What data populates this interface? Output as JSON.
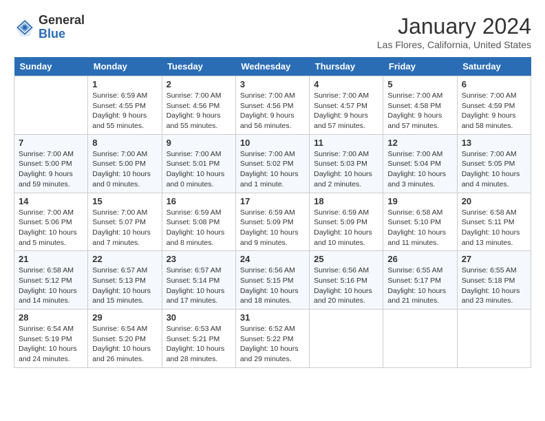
{
  "header": {
    "logo_general": "General",
    "logo_blue": "Blue",
    "month_title": "January 2024",
    "location": "Las Flores, California, United States"
  },
  "days_of_week": [
    "Sunday",
    "Monday",
    "Tuesday",
    "Wednesday",
    "Thursday",
    "Friday",
    "Saturday"
  ],
  "weeks": [
    [
      {
        "day": "",
        "sunrise": "",
        "sunset": "",
        "daylight": ""
      },
      {
        "day": "1",
        "sunrise": "Sunrise: 6:59 AM",
        "sunset": "Sunset: 4:55 PM",
        "daylight": "Daylight: 9 hours and 55 minutes."
      },
      {
        "day": "2",
        "sunrise": "Sunrise: 7:00 AM",
        "sunset": "Sunset: 4:56 PM",
        "daylight": "Daylight: 9 hours and 55 minutes."
      },
      {
        "day": "3",
        "sunrise": "Sunrise: 7:00 AM",
        "sunset": "Sunset: 4:56 PM",
        "daylight": "Daylight: 9 hours and 56 minutes."
      },
      {
        "day": "4",
        "sunrise": "Sunrise: 7:00 AM",
        "sunset": "Sunset: 4:57 PM",
        "daylight": "Daylight: 9 hours and 57 minutes."
      },
      {
        "day": "5",
        "sunrise": "Sunrise: 7:00 AM",
        "sunset": "Sunset: 4:58 PM",
        "daylight": "Daylight: 9 hours and 57 minutes."
      },
      {
        "day": "6",
        "sunrise": "Sunrise: 7:00 AM",
        "sunset": "Sunset: 4:59 PM",
        "daylight": "Daylight: 9 hours and 58 minutes."
      }
    ],
    [
      {
        "day": "7",
        "sunrise": "Sunrise: 7:00 AM",
        "sunset": "Sunset: 5:00 PM",
        "daylight": "Daylight: 9 hours and 59 minutes."
      },
      {
        "day": "8",
        "sunrise": "Sunrise: 7:00 AM",
        "sunset": "Sunset: 5:00 PM",
        "daylight": "Daylight: 10 hours and 0 minutes."
      },
      {
        "day": "9",
        "sunrise": "Sunrise: 7:00 AM",
        "sunset": "Sunset: 5:01 PM",
        "daylight": "Daylight: 10 hours and 0 minutes."
      },
      {
        "day": "10",
        "sunrise": "Sunrise: 7:00 AM",
        "sunset": "Sunset: 5:02 PM",
        "daylight": "Daylight: 10 hours and 1 minute."
      },
      {
        "day": "11",
        "sunrise": "Sunrise: 7:00 AM",
        "sunset": "Sunset: 5:03 PM",
        "daylight": "Daylight: 10 hours and 2 minutes."
      },
      {
        "day": "12",
        "sunrise": "Sunrise: 7:00 AM",
        "sunset": "Sunset: 5:04 PM",
        "daylight": "Daylight: 10 hours and 3 minutes."
      },
      {
        "day": "13",
        "sunrise": "Sunrise: 7:00 AM",
        "sunset": "Sunset: 5:05 PM",
        "daylight": "Daylight: 10 hours and 4 minutes."
      }
    ],
    [
      {
        "day": "14",
        "sunrise": "Sunrise: 7:00 AM",
        "sunset": "Sunset: 5:06 PM",
        "daylight": "Daylight: 10 hours and 5 minutes."
      },
      {
        "day": "15",
        "sunrise": "Sunrise: 7:00 AM",
        "sunset": "Sunset: 5:07 PM",
        "daylight": "Daylight: 10 hours and 7 minutes."
      },
      {
        "day": "16",
        "sunrise": "Sunrise: 6:59 AM",
        "sunset": "Sunset: 5:08 PM",
        "daylight": "Daylight: 10 hours and 8 minutes."
      },
      {
        "day": "17",
        "sunrise": "Sunrise: 6:59 AM",
        "sunset": "Sunset: 5:09 PM",
        "daylight": "Daylight: 10 hours and 9 minutes."
      },
      {
        "day": "18",
        "sunrise": "Sunrise: 6:59 AM",
        "sunset": "Sunset: 5:09 PM",
        "daylight": "Daylight: 10 hours and 10 minutes."
      },
      {
        "day": "19",
        "sunrise": "Sunrise: 6:58 AM",
        "sunset": "Sunset: 5:10 PM",
        "daylight": "Daylight: 10 hours and 11 minutes."
      },
      {
        "day": "20",
        "sunrise": "Sunrise: 6:58 AM",
        "sunset": "Sunset: 5:11 PM",
        "daylight": "Daylight: 10 hours and 13 minutes."
      }
    ],
    [
      {
        "day": "21",
        "sunrise": "Sunrise: 6:58 AM",
        "sunset": "Sunset: 5:12 PM",
        "daylight": "Daylight: 10 hours and 14 minutes."
      },
      {
        "day": "22",
        "sunrise": "Sunrise: 6:57 AM",
        "sunset": "Sunset: 5:13 PM",
        "daylight": "Daylight: 10 hours and 15 minutes."
      },
      {
        "day": "23",
        "sunrise": "Sunrise: 6:57 AM",
        "sunset": "Sunset: 5:14 PM",
        "daylight": "Daylight: 10 hours and 17 minutes."
      },
      {
        "day": "24",
        "sunrise": "Sunrise: 6:56 AM",
        "sunset": "Sunset: 5:15 PM",
        "daylight": "Daylight: 10 hours and 18 minutes."
      },
      {
        "day": "25",
        "sunrise": "Sunrise: 6:56 AM",
        "sunset": "Sunset: 5:16 PM",
        "daylight": "Daylight: 10 hours and 20 minutes."
      },
      {
        "day": "26",
        "sunrise": "Sunrise: 6:55 AM",
        "sunset": "Sunset: 5:17 PM",
        "daylight": "Daylight: 10 hours and 21 minutes."
      },
      {
        "day": "27",
        "sunrise": "Sunrise: 6:55 AM",
        "sunset": "Sunset: 5:18 PM",
        "daylight": "Daylight: 10 hours and 23 minutes."
      }
    ],
    [
      {
        "day": "28",
        "sunrise": "Sunrise: 6:54 AM",
        "sunset": "Sunset: 5:19 PM",
        "daylight": "Daylight: 10 hours and 24 minutes."
      },
      {
        "day": "29",
        "sunrise": "Sunrise: 6:54 AM",
        "sunset": "Sunset: 5:20 PM",
        "daylight": "Daylight: 10 hours and 26 minutes."
      },
      {
        "day": "30",
        "sunrise": "Sunrise: 6:53 AM",
        "sunset": "Sunset: 5:21 PM",
        "daylight": "Daylight: 10 hours and 28 minutes."
      },
      {
        "day": "31",
        "sunrise": "Sunrise: 6:52 AM",
        "sunset": "Sunset: 5:22 PM",
        "daylight": "Daylight: 10 hours and 29 minutes."
      },
      {
        "day": "",
        "sunrise": "",
        "sunset": "",
        "daylight": ""
      },
      {
        "day": "",
        "sunrise": "",
        "sunset": "",
        "daylight": ""
      },
      {
        "day": "",
        "sunrise": "",
        "sunset": "",
        "daylight": ""
      }
    ]
  ]
}
